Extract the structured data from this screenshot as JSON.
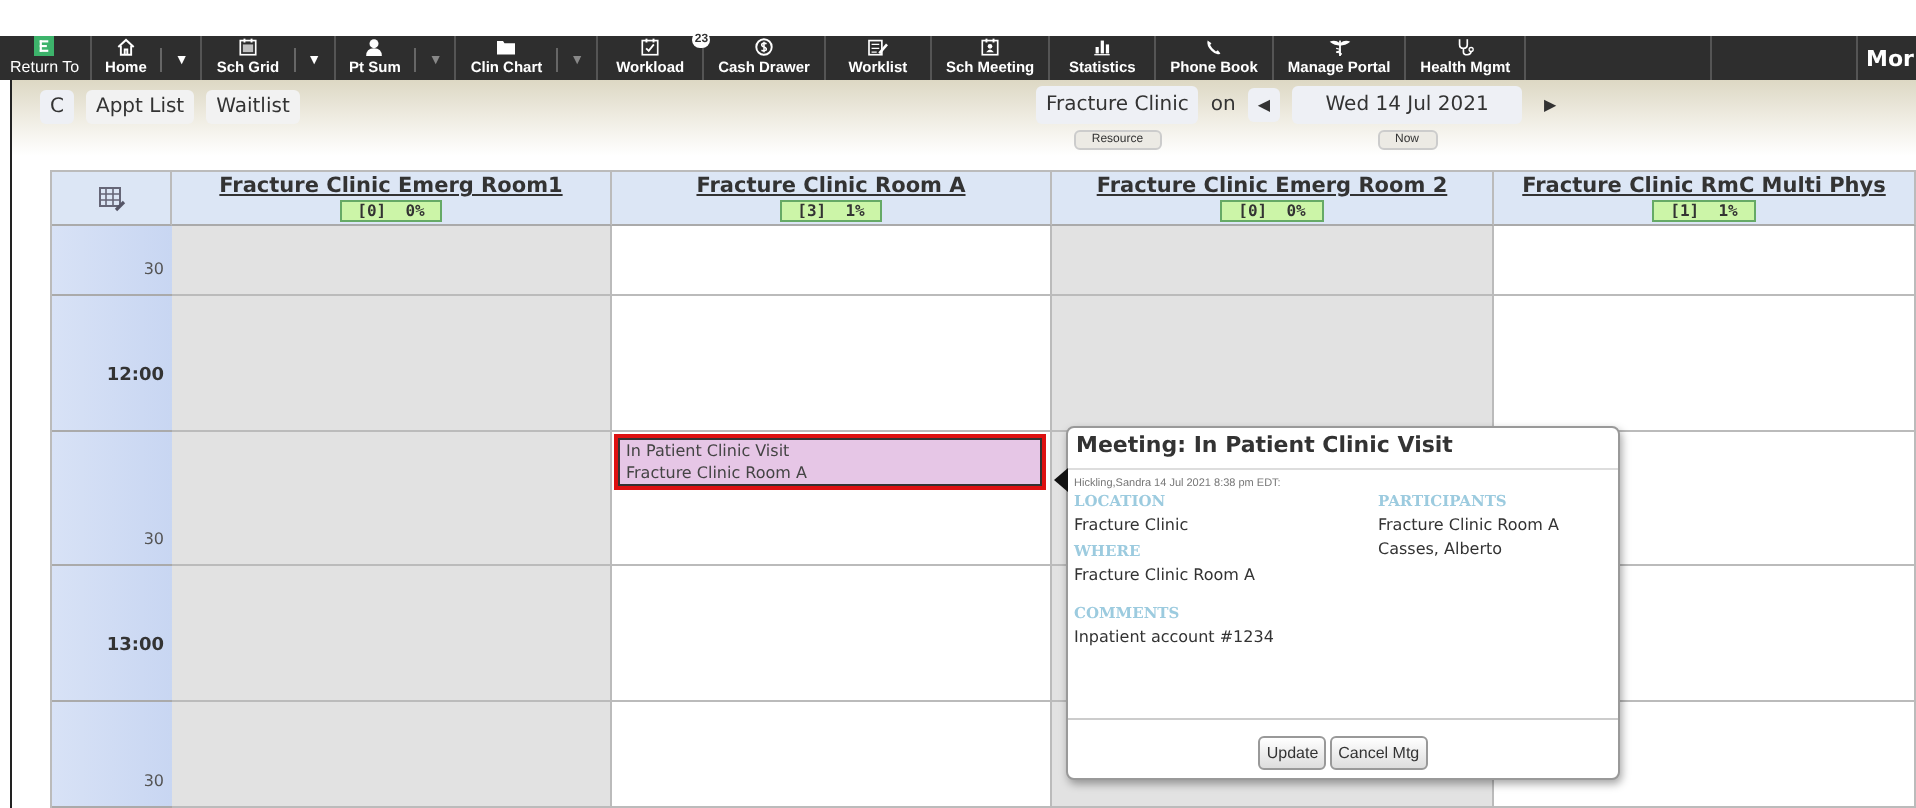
{
  "toolbar": {
    "items": [
      {
        "label": "Return To"
      },
      {
        "label": "Home",
        "menu_glyph": "▼",
        "menu_disabled": false
      },
      {
        "label": "Sch Grid",
        "menu_glyph": "▼",
        "menu_disabled": false
      },
      {
        "label": "Pt Sum",
        "menu_glyph": "▼",
        "menu_disabled": true
      },
      {
        "label": "Clin Chart",
        "menu_glyph": "▼",
        "menu_disabled": true
      },
      {
        "label": "Workload",
        "badge": "23"
      },
      {
        "label": "Cash Drawer"
      },
      {
        "label": "Worklist"
      },
      {
        "label": "Sch Meeting"
      },
      {
        "label": "Statistics"
      },
      {
        "label": "Phone Book"
      },
      {
        "label": "Manage Portal"
      },
      {
        "label": "Health Mgmt"
      }
    ],
    "more": "Mor"
  },
  "subbar": {
    "refresh": "C",
    "tabs": [
      "Appt List",
      "Waitlist"
    ],
    "resource": "Fracture Clinic",
    "resource_hint": "Resource",
    "on": "on",
    "prev": "◀",
    "date": "Wed 14 Jul 2021",
    "next": "▶",
    "now": "Now"
  },
  "schedule": {
    "columns": [
      {
        "title": "Fracture Clinic Emerg Room1",
        "stats": "[0]  0%"
      },
      {
        "title": "Fracture Clinic Room A",
        "stats": "[3]  1%"
      },
      {
        "title": "Fracture Clinic Emerg Room 2",
        "stats": "[0]  0%"
      },
      {
        "title": "Fracture Clinic RmC Multi Phys",
        "stats": "[1]  1%"
      }
    ],
    "rows": [
      {
        "time": "30",
        "kind": "half",
        "cells": [
          {
            "unavailable": true
          },
          {
            "unavailable": false
          },
          {
            "unavailable": true
          },
          {
            "unavailable": false
          }
        ]
      },
      {
        "time": "12:00",
        "kind": "hour",
        "cells": [
          {
            "unavailable": true
          },
          {
            "unavailable": false
          },
          {
            "unavailable": true
          },
          {
            "unavailable": false
          }
        ]
      },
      {
        "time": "30",
        "kind": "half",
        "cells": [
          {
            "unavailable": true
          },
          {
            "unavailable": false,
            "appointment": {
              "lines": [
                "In Patient Clinic Visit",
                "Fracture Clinic Room A"
              ],
              "selected": true
            }
          },
          {
            "unavailable": true
          },
          {
            "unavailable": false
          }
        ]
      },
      {
        "time": "13:00",
        "kind": "hour",
        "cells": [
          {
            "unavailable": true
          },
          {
            "unavailable": false
          },
          {
            "unavailable": true
          },
          {
            "unavailable": false
          }
        ]
      },
      {
        "time": "30",
        "kind": "half",
        "cells": [
          {
            "unavailable": true
          },
          {
            "unavailable": false
          },
          {
            "unavailable": true
          },
          {
            "unavailable": false
          }
        ]
      }
    ]
  },
  "popup": {
    "title": "Meeting: In Patient Clinic Visit",
    "meta": "Hickling,Sandra 14 Jul 2021 8:38 pm EDT:",
    "columns": [
      {
        "sections": [
          {
            "heading": "LOCATION",
            "lines": [
              "Fracture Clinic"
            ]
          },
          {
            "heading": "WHERE",
            "lines": [
              "Fracture Clinic Room A"
            ]
          },
          {
            "heading": "COMMENTS",
            "lines": [
              "Inpatient account #1234"
            ]
          }
        ]
      },
      {
        "sections": [
          {
            "heading": "PARTICIPANTS",
            "lines": [
              "Fracture Clinic Room A",
              "Casses, Alberto"
            ]
          }
        ]
      }
    ],
    "buttons": [
      "Update",
      "Cancel Mtg"
    ]
  }
}
